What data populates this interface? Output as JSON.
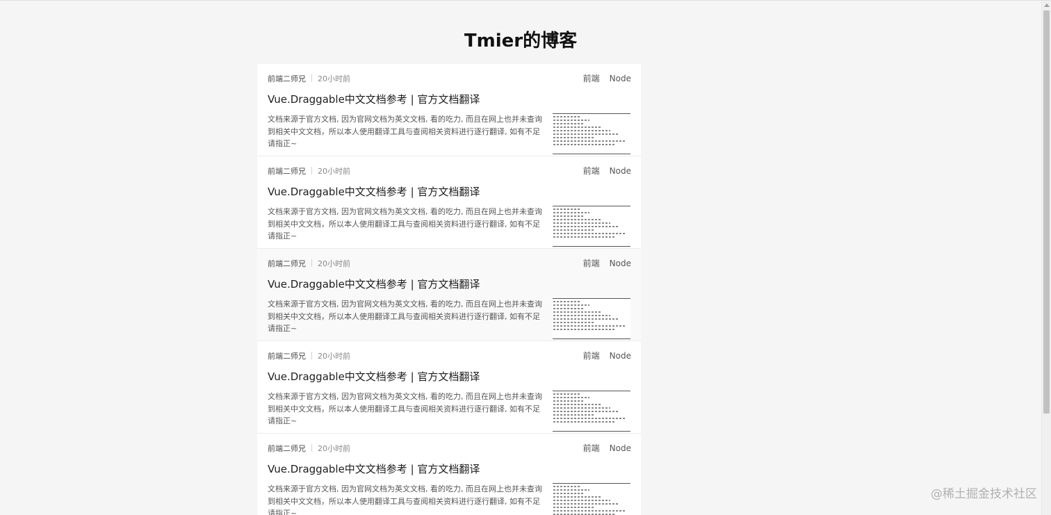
{
  "blog": {
    "title": "Tmier的博客"
  },
  "articles": [
    {
      "author": "前端二师兄",
      "time": "20小时前",
      "tags": [
        "前端",
        "Node"
      ],
      "title": "Vue.Draggable中文文档参考 | 官方文档翻译",
      "excerpt": "文档来源于官方文档, 因为官网文档为英文文档, 看的吃力, 而且在网上也并未查询到相关中文文档，所以本人使用翻译工具与查阅相关资料进行逐行翻译, 如有不足请指正~"
    },
    {
      "author": "前端二师兄",
      "time": "20小时前",
      "tags": [
        "前端",
        "Node"
      ],
      "title": "Vue.Draggable中文文档参考 | 官方文档翻译",
      "excerpt": "文档来源于官方文档, 因为官网文档为英文文档, 看的吃力, 而且在网上也并未查询到相关中文文档，所以本人使用翻译工具与查阅相关资料进行逐行翻译, 如有不足请指正~"
    },
    {
      "author": "前端二师兄",
      "time": "20小时前",
      "tags": [
        "前端",
        "Node"
      ],
      "title": "Vue.Draggable中文文档参考 | 官方文档翻译",
      "excerpt": "文档来源于官方文档, 因为官网文档为英文文档, 看的吃力, 而且在网上也并未查询到相关中文文档，所以本人使用翻译工具与查阅相关资料进行逐行翻译, 如有不足请指正~"
    },
    {
      "author": "前端二师兄",
      "time": "20小时前",
      "tags": [
        "前端",
        "Node"
      ],
      "title": "Vue.Draggable中文文档参考 | 官方文档翻译",
      "excerpt": "文档来源于官方文档, 因为官网文档为英文文档, 看的吃力, 而且在网上也并未查询到相关中文文档，所以本人使用翻译工具与查阅相关资料进行逐行翻译, 如有不足请指正~"
    },
    {
      "author": "前端二师兄",
      "time": "20小时前",
      "tags": [
        "前端",
        "Node"
      ],
      "title": "Vue.Draggable中文文档参考 | 官方文档翻译",
      "excerpt": "文档来源于官方文档, 因为官网文档为英文文档, 看的吃力, 而且在网上也并未查询到相关中文文档，所以本人使用翻译工具与查阅相关资料进行逐行翻译, 如有不足请指正~"
    }
  ],
  "watermark": "@稀土掘金技术社区"
}
